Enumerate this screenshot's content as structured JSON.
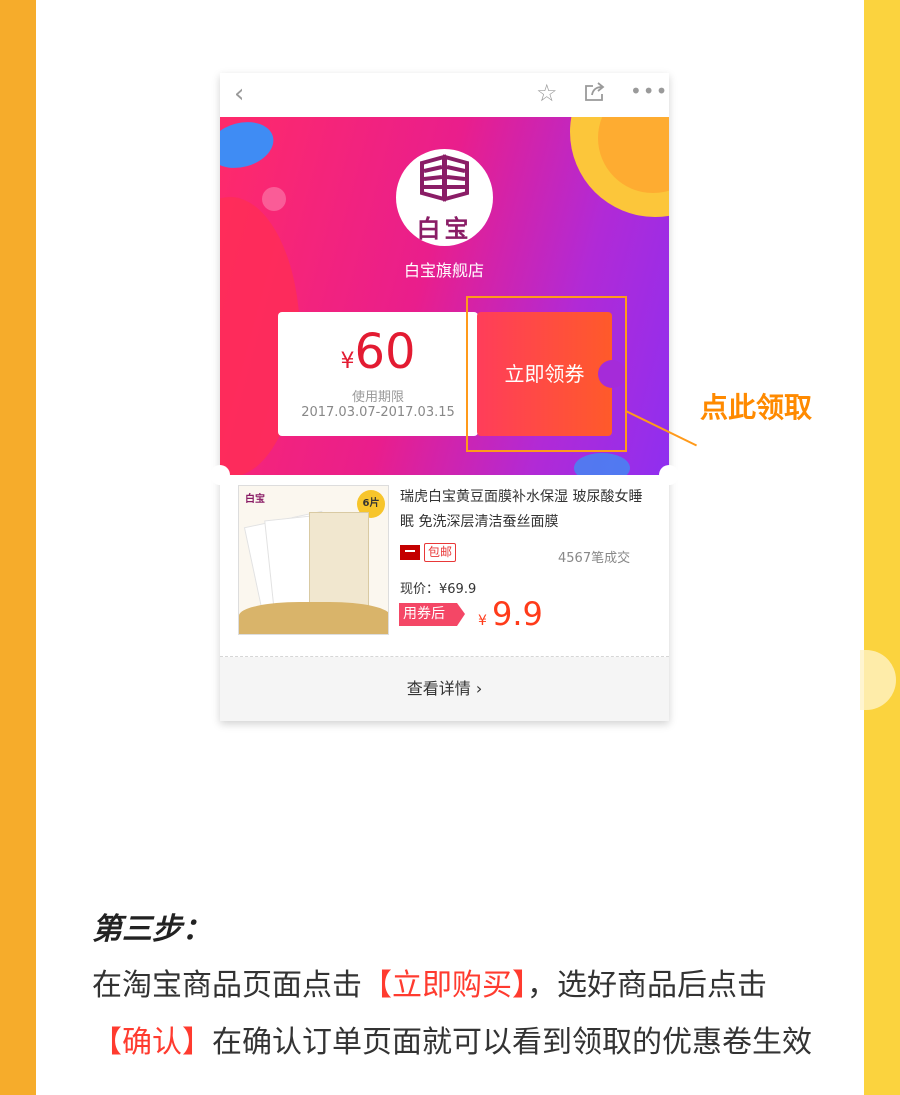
{
  "colors": {
    "left_strip": "#f6ac2b",
    "right_strip": "#fbd33e",
    "accent_orange": "#ff8a00",
    "highlight_red": "#ff3b2f"
  },
  "topbar": {
    "back_icon": "chevron-left-icon",
    "star_icon": "star-icon",
    "share_icon": "share-icon",
    "more_icon": "more-icon"
  },
  "shop": {
    "logo_text": "白宝",
    "name": "白宝旗舰店"
  },
  "coupon": {
    "currency": "¥",
    "amount": "60",
    "valid_label": "使用期限",
    "valid_dates": "2017.03.07-2017.03.15",
    "claim_label": "立即领券"
  },
  "callout": {
    "text": "点此领取"
  },
  "product": {
    "title": "瑞虎白宝黄豆面膜补水保湿 玻尿酸女睡眠 免洗深层清洁蚕丝面膜",
    "free_shipping": "包邮",
    "sales": "4567笔成交",
    "current_price": "现价：¥69.9",
    "after_coupon_label": "用券后",
    "final_currency": "¥",
    "final_price": "9.9",
    "image_badge": "6片",
    "image_logo": "白宝"
  },
  "details": {
    "label": "查看详情",
    "chevron": "›"
  },
  "step": {
    "title": "第三步：",
    "line_a": "在淘宝商品页面点击",
    "highlight_a": "【立即购买】",
    "line_b": "，选好商品后点击",
    "highlight_b": "【确认】",
    "line_c": "在确认订单页面就可以看到领取的优惠卷生效"
  }
}
